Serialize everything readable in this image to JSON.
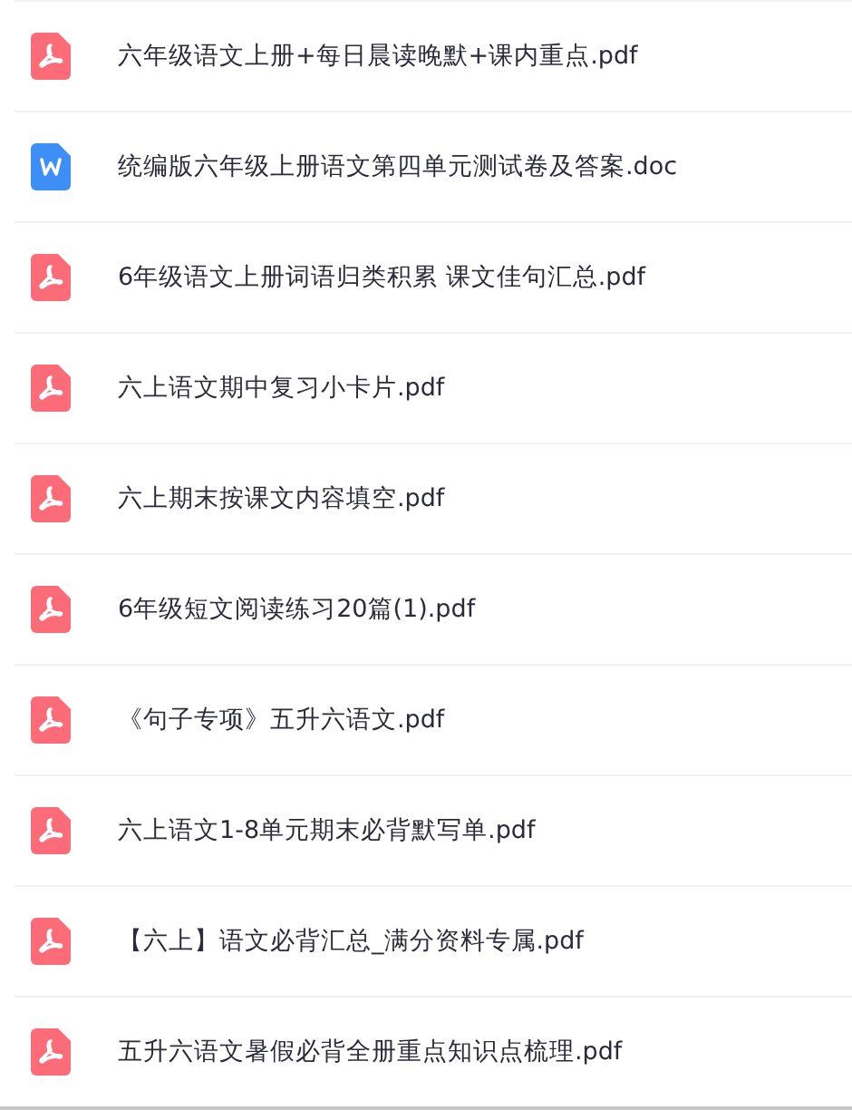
{
  "files": [
    {
      "kind": "pdf",
      "name": "六年级语文上册+每日晨读晚默+课内重点.pdf"
    },
    {
      "kind": "doc",
      "name": "统编版六年级上册语文第四单元测试卷及答案.doc"
    },
    {
      "kind": "pdf",
      "name": "6年级语文上册词语归类积累 课文佳句汇总.pdf"
    },
    {
      "kind": "pdf",
      "name": "六上语文期中复习小卡片.pdf"
    },
    {
      "kind": "pdf",
      "name": "六上期末按课文内容填空.pdf"
    },
    {
      "kind": "pdf",
      "name": "6年级短文阅读练习20篇(1).pdf"
    },
    {
      "kind": "pdf",
      "name": "《句子专项》五升六语文.pdf"
    },
    {
      "kind": "pdf",
      "name": "六上语文1-8单元期末必背默写单.pdf"
    },
    {
      "kind": "pdf",
      "name": "【六上】语文必背汇总_满分资料专属.pdf"
    },
    {
      "kind": "pdf",
      "name": "五升六语文暑假必背全册重点知识点梳理.pdf"
    }
  ]
}
